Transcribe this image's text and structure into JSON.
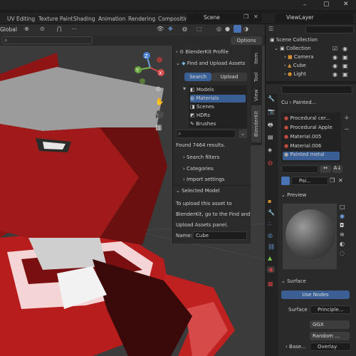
{
  "topbar": {
    "scene": "Scene",
    "view_layer": "ViewLayer"
  },
  "workspaces": [
    "UV Editing",
    "Texture Paint",
    "Shading",
    "Animation",
    "Rendering",
    "Compositin"
  ],
  "viewport": {
    "orientation": "Global",
    "options": "Options"
  },
  "axis_labels": {
    "x": "X",
    "y": "Y",
    "z": "Z"
  },
  "npanel": {
    "tabs": [
      "Item",
      "Tool",
      "View",
      "BlenderKit"
    ],
    "profile": "BlenderKit Profile",
    "find_upload": "Find and Upload Assets",
    "search_btn": "Search",
    "upload_btn": "Upload",
    "categories": [
      "Models",
      "Materials",
      "Scenes",
      "HDRs",
      "Brushes"
    ],
    "results": "Found 7464 results.",
    "sections": [
      "Search filters",
      "Categories",
      "Import settings"
    ],
    "selected_model": "Selected Model",
    "help": [
      "To upload this asset to",
      "BlenderKit, go to the Find and",
      "Upload Assets panel."
    ],
    "name_label": "Name:",
    "name_value": "Cube"
  },
  "outliner": {
    "root": "Scene Collection",
    "collection": "Collection",
    "items": [
      "Camera",
      "Cube",
      "Light"
    ]
  },
  "props": {
    "crumb1": "Cu",
    "crumb2": "Painted...",
    "materials": [
      "Procedural cer...",
      "Procedural Apple",
      "Material.005",
      "Material.006",
      "Painted metal"
    ],
    "mat_field": "Pai...",
    "preview": "Preview",
    "surface": "Surface",
    "use_nodes": "Use Nodes",
    "surface_label": "Surface",
    "surface_value": "Principle...",
    "ggx": "GGX",
    "random": "Random ...",
    "base": "Base...",
    "overlay": "Overlay"
  }
}
